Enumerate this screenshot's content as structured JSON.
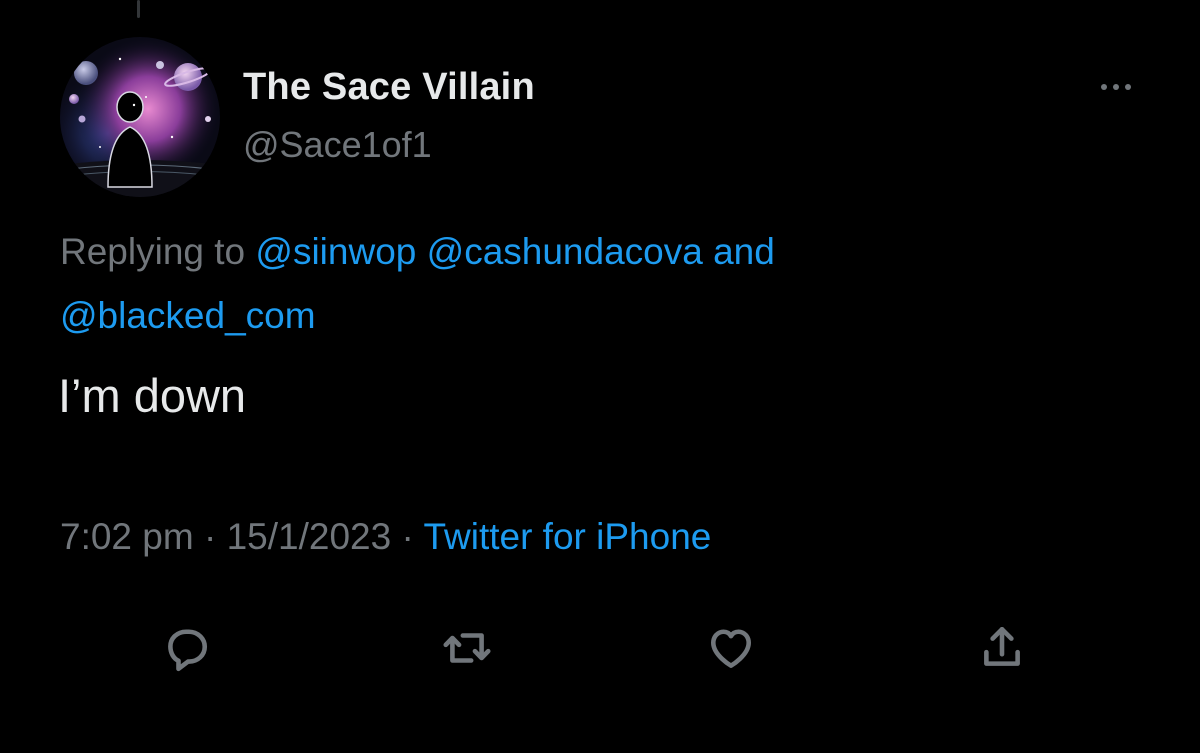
{
  "tweet": {
    "author": {
      "display_name": "The Sace Villain",
      "handle": "@Sace1of1"
    },
    "reply_context": {
      "prefix": "Replying to",
      "mentions": [
        "@siinwop",
        "@cashundacova"
      ],
      "conjunction": "and",
      "last_mention": "@blacked_com"
    },
    "text": "I’m down",
    "timestamp": {
      "time": "7:02 pm",
      "separator": "·",
      "date": "15/1/2023",
      "source": "Twitter for iPhone"
    },
    "actions": [
      {
        "name": "reply",
        "icon": "reply-icon"
      },
      {
        "name": "retweet",
        "icon": "retweet-icon"
      },
      {
        "name": "like",
        "icon": "heart-icon"
      },
      {
        "name": "share",
        "icon": "share-icon"
      }
    ]
  },
  "colors": {
    "background": "#000000",
    "primary_text": "#e7e9ea",
    "secondary_text": "#71767b",
    "link": "#1d9bf0"
  }
}
